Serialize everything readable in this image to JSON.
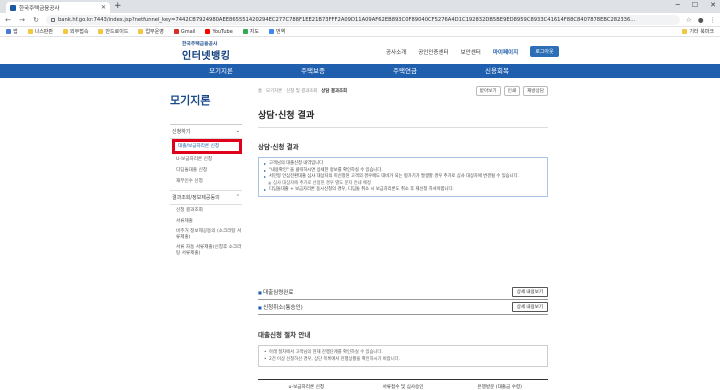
{
  "browser": {
    "tab_title": "한국주택금융공사",
    "new_tab": "+",
    "url": "bank.hf.go.kr:7443/index.jsp?netfunnel_key=7442CB7924980AEE865551420294EC277C788F1EE21B73FFF2A09D11A09AF62EB893C0F89040CF5276A4D1C192832DB5BE9ED8959C8933C41614F88C8407878EBC282336...",
    "bookmarks": [
      "앱",
      "나스판판",
      "외부접속",
      "안드로이드",
      "업무운영",
      "Gmail",
      "YouTube",
      "지도",
      "번역"
    ],
    "bookmarks_right": "기타 북마크"
  },
  "site": {
    "logo_small": "한국주택금융공사",
    "logo_big": "인터넷뱅킹",
    "util_links": [
      "공사소개",
      "공인인증센터",
      "보안센터",
      "마이페이지"
    ],
    "logout": "로그아웃",
    "gnb": [
      "모기지론",
      "주택보증",
      "주택연금",
      "신용회복"
    ]
  },
  "lnb": {
    "title": "모기지론",
    "groups": [
      {
        "label": "신청하기",
        "toggle": "⌄",
        "items": [
          {
            "label": "대출/보금자리론 신청",
            "active": true
          },
          {
            "label": "U-보금자리론 신청",
            "active": false
          },
          {
            "label": "디딤돌대출 신청",
            "active": false
          },
          {
            "label": "재무인수 신청",
            "active": false
          }
        ]
      },
      {
        "label": "결과조회/정보제공동의",
        "toggle": "⌃",
        "items": [
          {
            "label": "신청 결과조회",
            "active": false
          },
          {
            "label": "서류제출",
            "active": false
          },
          {
            "label": "비주거 정보제공동의 (소크라탕 서류제출)",
            "active": false
          },
          {
            "label": "서류 자동 서류제출(신청후 소크라탕 서류제출)",
            "active": false
          }
        ]
      }
    ]
  },
  "content": {
    "breadcrumb": [
      "홈",
      "모기지론",
      "신청 및 결과조회",
      "상담 결과조회"
    ],
    "crumb_buttons": [
      "받아보기",
      "인쇄",
      "재방상담"
    ],
    "page_title": "상담·신청 결과",
    "section_title": "상담·신청 결과",
    "notices": [
      {
        "text": "고객님의 대출신청 내역입니다",
        "type": "main"
      },
      {
        "text": "\"내용확인\" 을 클릭하시면 상세한 정보를 확인하실 수 있습니다.",
        "type": "red"
      },
      {
        "text": "서민형 안심전환대출 심사 대상자의 미신청된 고객의 경우에도 대비가 되는 평가기가 발생할 경우 추가로 심사 대상자에 변경될 수 있습니다.",
        "type": "main"
      },
      {
        "text": "심사 대상자에 추가로 선정된 경우 별도 문자 안내 예정",
        "type": "sub"
      },
      {
        "text": "디딤돌대출 + 보금자리론 동시신청의 경우, 디딤돌 취소 시 보금자리론도 취소 후 재신청 하셔야합니다.",
        "type": "main"
      }
    ],
    "status_rows": [
      {
        "label": "대출심령완료",
        "button": "상세 내용보기"
      },
      {
        "label": "신청취소(통승인)",
        "button": "상세 내용보기"
      }
    ],
    "guide_title": "대출신청 절차 안내",
    "guide_items": [
      "아래 절차에서 고객님의 현재 진행단계를 확인하실 수 있습니다.",
      "2건 이상 신청하신 경우, 상단 목록에서 진행상황을 확인하시기 바랍니다."
    ],
    "table_headers": [
      "u-보금자리론 신청",
      "서류접수 및 심사승인",
      "은행방문 (대출금 수령)"
    ]
  },
  "colors": {
    "gnb": "#1f5fae",
    "highlight": "#e0001b"
  }
}
